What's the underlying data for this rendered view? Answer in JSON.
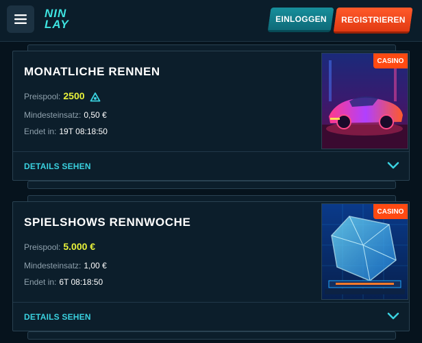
{
  "header": {
    "logo_line1": "NIN",
    "logo_line2": "LAY",
    "login_label": "EINLOGGEN",
    "register_label": "REGISTRIEREN"
  },
  "colors": {
    "accent_cyan": "#3ad2e0",
    "highlight_yellow": "#e9f23a",
    "badge_orange": "#ff4a12"
  },
  "cards": [
    {
      "title": "MONATLICHE RENNEN",
      "prize_label": "Preispool:",
      "prize_value": "2500",
      "prize_icon": "coin-icon",
      "min_bet_label": "Mindesteinsatz:",
      "min_bet_value": "0,50 €",
      "ends_label": "Endet in:",
      "ends_value": "19T 08:18:50",
      "badge": "CASINO",
      "details_label": "DETAILS SEHEN"
    },
    {
      "title": "SPIELSHOWS RENNWOCHE",
      "prize_label": "Preispool:",
      "prize_value": "5.000 €",
      "min_bet_label": "Mindesteinsatz:",
      "min_bet_value": "1,00 €",
      "ends_label": "Endet in:",
      "ends_value": "6T 08:18:50",
      "badge": "CASINO",
      "details_label": "DETAILS SEHEN"
    }
  ]
}
